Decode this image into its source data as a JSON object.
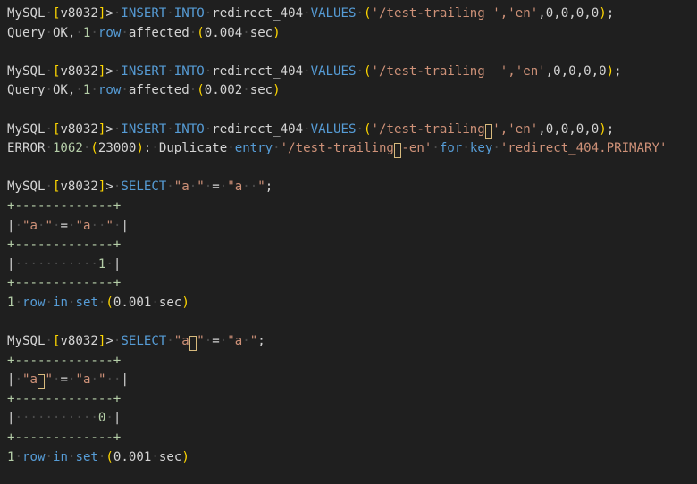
{
  "colors": {
    "background": "#1f1f1f",
    "default": "#d4d4d4",
    "keyword": "#569cd6",
    "string": "#ce9178",
    "number": "#b5cea8",
    "bracket": "#ffd700",
    "whitespace_dot": "#4b4b4b",
    "invisible_char_box": "#d7ba7d"
  },
  "lines": [
    {
      "name": "insert-statement-1",
      "segments": [
        {
          "t": "MySQL",
          "c": "default"
        },
        {
          "t": " ",
          "ws": true
        },
        {
          "t": "[",
          "c": "bracket"
        },
        {
          "t": "v8032",
          "c": "default"
        },
        {
          "t": "]",
          "c": "bracket"
        },
        {
          "t": ">",
          "c": "default"
        },
        {
          "t": " ",
          "ws": true
        },
        {
          "t": "INSERT",
          "c": "keyword"
        },
        {
          "t": " ",
          "ws": true
        },
        {
          "t": "INTO",
          "c": "keyword"
        },
        {
          "t": " ",
          "ws": true
        },
        {
          "t": "redirect_404",
          "c": "default"
        },
        {
          "t": " ",
          "ws": true
        },
        {
          "t": "VALUES",
          "c": "keyword"
        },
        {
          "t": " ",
          "ws": true
        },
        {
          "t": "(",
          "c": "bracket"
        },
        {
          "t": "'/test-trailing ','en'",
          "c": "string"
        },
        {
          "t": ",",
          "c": "default"
        },
        {
          "t": "0",
          "c": "default"
        },
        {
          "t": ",",
          "c": "default"
        },
        {
          "t": "0",
          "c": "default"
        },
        {
          "t": ",",
          "c": "default"
        },
        {
          "t": "0",
          "c": "default"
        },
        {
          "t": ",",
          "c": "default"
        },
        {
          "t": "0",
          "c": "default"
        },
        {
          "t": ")",
          "c": "bracket"
        },
        {
          "t": ";",
          "c": "default"
        }
      ]
    },
    {
      "name": "result-line-1",
      "segments": [
        {
          "t": "Query",
          "c": "default"
        },
        {
          "t": " ",
          "ws": true
        },
        {
          "t": "OK,",
          "c": "default"
        },
        {
          "t": " ",
          "ws": true
        },
        {
          "t": "1",
          "c": "number"
        },
        {
          "t": " ",
          "ws": true
        },
        {
          "t": "row",
          "c": "keyword"
        },
        {
          "t": " ",
          "ws": true
        },
        {
          "t": "affected",
          "c": "default"
        },
        {
          "t": " ",
          "ws": true
        },
        {
          "t": "(",
          "c": "bracket"
        },
        {
          "t": "0.004",
          "c": "default"
        },
        {
          "t": " ",
          "ws": true
        },
        {
          "t": "sec",
          "c": "default"
        },
        {
          "t": ")",
          "c": "bracket"
        }
      ]
    },
    {
      "name": "blank-line",
      "segments": []
    },
    {
      "name": "insert-statement-2",
      "segments": [
        {
          "t": "MySQL",
          "c": "default"
        },
        {
          "t": " ",
          "ws": true
        },
        {
          "t": "[",
          "c": "bracket"
        },
        {
          "t": "v8032",
          "c": "default"
        },
        {
          "t": "]",
          "c": "bracket"
        },
        {
          "t": ">",
          "c": "default"
        },
        {
          "t": " ",
          "ws": true
        },
        {
          "t": "INSERT",
          "c": "keyword"
        },
        {
          "t": " ",
          "ws": true
        },
        {
          "t": "INTO",
          "c": "keyword"
        },
        {
          "t": " ",
          "ws": true
        },
        {
          "t": "redirect_404",
          "c": "default"
        },
        {
          "t": " ",
          "ws": true
        },
        {
          "t": "VALUES",
          "c": "keyword"
        },
        {
          "t": " ",
          "ws": true
        },
        {
          "t": "(",
          "c": "bracket"
        },
        {
          "t": "'/test-trailing  ','en'",
          "c": "string"
        },
        {
          "t": ",",
          "c": "default"
        },
        {
          "t": "0",
          "c": "default"
        },
        {
          "t": ",",
          "c": "default"
        },
        {
          "t": "0",
          "c": "default"
        },
        {
          "t": ",",
          "c": "default"
        },
        {
          "t": "0",
          "c": "default"
        },
        {
          "t": ",",
          "c": "default"
        },
        {
          "t": "0",
          "c": "default"
        },
        {
          "t": ")",
          "c": "bracket"
        },
        {
          "t": ";",
          "c": "default"
        }
      ]
    },
    {
      "name": "result-line-2",
      "segments": [
        {
          "t": "Query",
          "c": "default"
        },
        {
          "t": " ",
          "ws": true
        },
        {
          "t": "OK,",
          "c": "default"
        },
        {
          "t": " ",
          "ws": true
        },
        {
          "t": "1",
          "c": "number"
        },
        {
          "t": " ",
          "ws": true
        },
        {
          "t": "row",
          "c": "keyword"
        },
        {
          "t": " ",
          "ws": true
        },
        {
          "t": "affected",
          "c": "default"
        },
        {
          "t": " ",
          "ws": true
        },
        {
          "t": "(",
          "c": "bracket"
        },
        {
          "t": "0.002",
          "c": "default"
        },
        {
          "t": " ",
          "ws": true
        },
        {
          "t": "sec",
          "c": "default"
        },
        {
          "t": ")",
          "c": "bracket"
        }
      ]
    },
    {
      "name": "blank-line",
      "segments": []
    },
    {
      "name": "insert-statement-3",
      "segments": [
        {
          "t": "MySQL",
          "c": "default"
        },
        {
          "t": " ",
          "ws": true
        },
        {
          "t": "[",
          "c": "bracket"
        },
        {
          "t": "v8032",
          "c": "default"
        },
        {
          "t": "]",
          "c": "bracket"
        },
        {
          "t": ">",
          "c": "default"
        },
        {
          "t": " ",
          "ws": true
        },
        {
          "t": "INSERT",
          "c": "keyword"
        },
        {
          "t": " ",
          "ws": true
        },
        {
          "t": "INTO",
          "c": "keyword"
        },
        {
          "t": " ",
          "ws": true
        },
        {
          "t": "redirect_404",
          "c": "default"
        },
        {
          "t": " ",
          "ws": true
        },
        {
          "t": "VALUES",
          "c": "keyword"
        },
        {
          "t": " ",
          "ws": true
        },
        {
          "t": "(",
          "c": "bracket"
        },
        {
          "t": "'/test-trailing",
          "c": "string"
        },
        {
          "t": " ",
          "c": "string",
          "box": true
        },
        {
          "t": "','en'",
          "c": "string"
        },
        {
          "t": ",",
          "c": "default"
        },
        {
          "t": "0",
          "c": "default"
        },
        {
          "t": ",",
          "c": "default"
        },
        {
          "t": "0",
          "c": "default"
        },
        {
          "t": ",",
          "c": "default"
        },
        {
          "t": "0",
          "c": "default"
        },
        {
          "t": ",",
          "c": "default"
        },
        {
          "t": "0",
          "c": "default"
        },
        {
          "t": ")",
          "c": "bracket"
        },
        {
          "t": ";",
          "c": "default"
        }
      ]
    },
    {
      "name": "error-line",
      "segments": [
        {
          "t": "ERROR",
          "c": "default"
        },
        {
          "t": " ",
          "ws": true
        },
        {
          "t": "1062",
          "c": "number"
        },
        {
          "t": " ",
          "ws": true
        },
        {
          "t": "(",
          "c": "bracket"
        },
        {
          "t": "23000",
          "c": "default"
        },
        {
          "t": ")",
          "c": "bracket"
        },
        {
          "t": ":",
          "c": "default"
        },
        {
          "t": " ",
          "ws": true
        },
        {
          "t": "Duplicate",
          "c": "default"
        },
        {
          "t": " ",
          "ws": true
        },
        {
          "t": "entry",
          "c": "keyword"
        },
        {
          "t": " ",
          "ws": true
        },
        {
          "t": "'/test-trailing",
          "c": "string"
        },
        {
          "t": " ",
          "c": "string",
          "box": true
        },
        {
          "t": "-en'",
          "c": "string"
        },
        {
          "t": " ",
          "ws": true
        },
        {
          "t": "for",
          "c": "keyword"
        },
        {
          "t": " ",
          "ws": true
        },
        {
          "t": "key",
          "c": "keyword"
        },
        {
          "t": " ",
          "ws": true
        },
        {
          "t": "'redirect_404.PRIMARY'",
          "c": "string"
        }
      ]
    },
    {
      "name": "blank-line",
      "segments": []
    },
    {
      "name": "select-statement-1",
      "segments": [
        {
          "t": "MySQL",
          "c": "default"
        },
        {
          "t": " ",
          "ws": true
        },
        {
          "t": "[",
          "c": "bracket"
        },
        {
          "t": "v8032",
          "c": "default"
        },
        {
          "t": "]",
          "c": "bracket"
        },
        {
          "t": ">",
          "c": "default"
        },
        {
          "t": " ",
          "ws": true
        },
        {
          "t": "SELECT",
          "c": "keyword"
        },
        {
          "t": " ",
          "ws": true
        },
        {
          "t": "\"a",
          "c": "string"
        },
        {
          "t": " ",
          "ws": true
        },
        {
          "t": "\"",
          "c": "string"
        },
        {
          "t": " ",
          "ws": true
        },
        {
          "t": "=",
          "c": "default"
        },
        {
          "t": " ",
          "ws": true
        },
        {
          "t": "\"a",
          "c": "string"
        },
        {
          "t": " ",
          "ws": true
        },
        {
          "t": " ",
          "ws": true
        },
        {
          "t": "\"",
          "c": "string"
        },
        {
          "t": ";",
          "c": "default"
        }
      ]
    },
    {
      "name": "table-border",
      "segments": [
        {
          "t": "+-------------+",
          "c": "number"
        }
      ]
    },
    {
      "name": "table-header",
      "segments": [
        {
          "t": "|",
          "c": "default"
        },
        {
          "t": " ",
          "ws": true
        },
        {
          "t": "\"a",
          "c": "string"
        },
        {
          "t": " ",
          "ws": true
        },
        {
          "t": "\"",
          "c": "string"
        },
        {
          "t": " ",
          "ws": true
        },
        {
          "t": "=",
          "c": "default"
        },
        {
          "t": " ",
          "ws": true
        },
        {
          "t": "\"a",
          "c": "string"
        },
        {
          "t": " ",
          "ws": true
        },
        {
          "t": " ",
          "ws": true
        },
        {
          "t": "\"",
          "c": "string"
        },
        {
          "t": " ",
          "ws": true
        },
        {
          "t": "|",
          "c": "default"
        }
      ]
    },
    {
      "name": "table-border",
      "segments": [
        {
          "t": "+-------------+",
          "c": "number"
        }
      ]
    },
    {
      "name": "table-row",
      "segments": [
        {
          "t": "|",
          "c": "default"
        },
        {
          "t": "           ",
          "ws": true
        },
        {
          "t": "1",
          "c": "number"
        },
        {
          "t": " ",
          "ws": true
        },
        {
          "t": "|",
          "c": "default"
        }
      ]
    },
    {
      "name": "table-border",
      "segments": [
        {
          "t": "+-------------+",
          "c": "number"
        }
      ]
    },
    {
      "name": "rowcount-line",
      "segments": [
        {
          "t": "1",
          "c": "number"
        },
        {
          "t": " ",
          "ws": true
        },
        {
          "t": "row",
          "c": "keyword"
        },
        {
          "t": " ",
          "ws": true
        },
        {
          "t": "in",
          "c": "keyword"
        },
        {
          "t": " ",
          "ws": true
        },
        {
          "t": "set",
          "c": "keyword"
        },
        {
          "t": " ",
          "ws": true
        },
        {
          "t": "(",
          "c": "bracket"
        },
        {
          "t": "0.001",
          "c": "default"
        },
        {
          "t": " ",
          "ws": true
        },
        {
          "t": "sec",
          "c": "default"
        },
        {
          "t": ")",
          "c": "bracket"
        }
      ]
    },
    {
      "name": "blank-line",
      "segments": []
    },
    {
      "name": "select-statement-2",
      "segments": [
        {
          "t": "MySQL",
          "c": "default"
        },
        {
          "t": " ",
          "ws": true
        },
        {
          "t": "[",
          "c": "bracket"
        },
        {
          "t": "v8032",
          "c": "default"
        },
        {
          "t": "]",
          "c": "bracket"
        },
        {
          "t": ">",
          "c": "default"
        },
        {
          "t": " ",
          "ws": true
        },
        {
          "t": "SELECT",
          "c": "keyword"
        },
        {
          "t": " ",
          "ws": true
        },
        {
          "t": "\"a",
          "c": "string"
        },
        {
          "t": " ",
          "c": "string",
          "box": true
        },
        {
          "t": "\"",
          "c": "string"
        },
        {
          "t": " ",
          "ws": true
        },
        {
          "t": "=",
          "c": "default"
        },
        {
          "t": " ",
          "ws": true
        },
        {
          "t": "\"a",
          "c": "string"
        },
        {
          "t": " ",
          "ws": true
        },
        {
          "t": "\"",
          "c": "string"
        },
        {
          "t": ";",
          "c": "default"
        }
      ]
    },
    {
      "name": "table-border",
      "segments": [
        {
          "t": "+-------------+",
          "c": "number"
        }
      ]
    },
    {
      "name": "table-header",
      "segments": [
        {
          "t": "|",
          "c": "default"
        },
        {
          "t": " ",
          "ws": true
        },
        {
          "t": "\"a",
          "c": "string"
        },
        {
          "t": " ",
          "c": "string",
          "box": true
        },
        {
          "t": "\"",
          "c": "string"
        },
        {
          "t": " ",
          "ws": true
        },
        {
          "t": "=",
          "c": "default"
        },
        {
          "t": " ",
          "ws": true
        },
        {
          "t": "\"a",
          "c": "string"
        },
        {
          "t": " ",
          "ws": true
        },
        {
          "t": "\"",
          "c": "string"
        },
        {
          "t": "  ",
          "ws": true
        },
        {
          "t": "|",
          "c": "default"
        }
      ]
    },
    {
      "name": "table-border",
      "segments": [
        {
          "t": "+-------------+",
          "c": "number"
        }
      ]
    },
    {
      "name": "table-row",
      "segments": [
        {
          "t": "|",
          "c": "default"
        },
        {
          "t": "           ",
          "ws": true
        },
        {
          "t": "0",
          "c": "number"
        },
        {
          "t": " ",
          "ws": true
        },
        {
          "t": "|",
          "c": "default"
        }
      ]
    },
    {
      "name": "table-border",
      "segments": [
        {
          "t": "+-------------+",
          "c": "number"
        }
      ]
    },
    {
      "name": "rowcount-line",
      "segments": [
        {
          "t": "1",
          "c": "number"
        },
        {
          "t": " ",
          "ws": true
        },
        {
          "t": "row",
          "c": "keyword"
        },
        {
          "t": " ",
          "ws": true
        },
        {
          "t": "in",
          "c": "keyword"
        },
        {
          "t": " ",
          "ws": true
        },
        {
          "t": "set",
          "c": "keyword"
        },
        {
          "t": " ",
          "ws": true
        },
        {
          "t": "(",
          "c": "bracket"
        },
        {
          "t": "0.001",
          "c": "default"
        },
        {
          "t": " ",
          "ws": true
        },
        {
          "t": "sec",
          "c": "default"
        },
        {
          "t": ")",
          "c": "bracket"
        }
      ]
    }
  ]
}
